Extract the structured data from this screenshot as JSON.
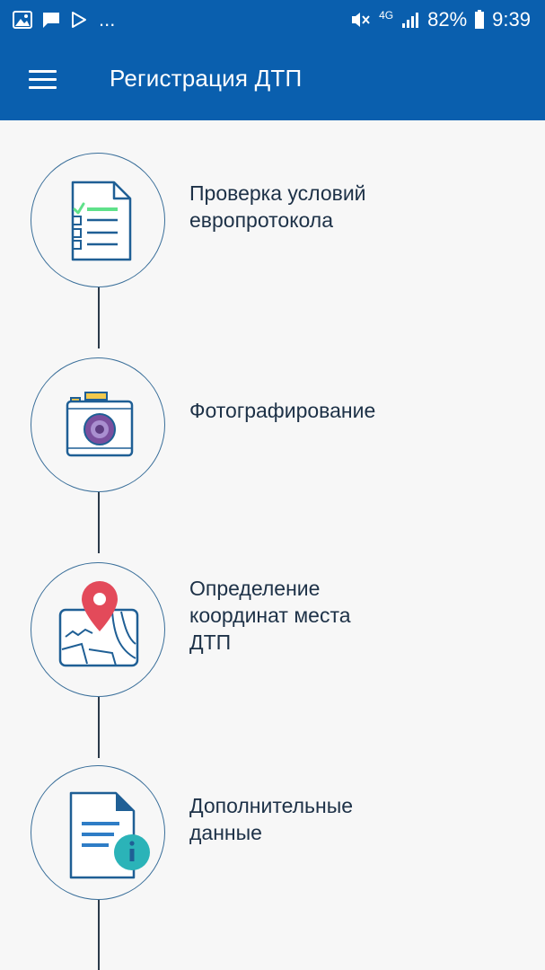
{
  "status_bar": {
    "dots": "...",
    "network": "4G",
    "battery": "82%",
    "time": "9:39",
    "icons": [
      "image-icon",
      "message-icon",
      "play-store-icon",
      "mute-icon",
      "signal-icon",
      "battery-icon"
    ]
  },
  "app_bar": {
    "title": "Регистрация ДТП",
    "menu_icon": "hamburger-menu-icon"
  },
  "steps": [
    {
      "label": "Проверка условий европротокола",
      "icon": "checklist-document-icon"
    },
    {
      "label": "Фотографирование",
      "icon": "camera-icon"
    },
    {
      "label": "Определение координат места ДТП",
      "icon": "map-pin-icon"
    },
    {
      "label": "Дополнительные данные",
      "icon": "document-info-icon"
    }
  ],
  "colors": {
    "primary": "#0a5fae",
    "background": "#f7f7f7",
    "outline": "#1f5f95",
    "accent_green": "#5fe18a",
    "accent_purple": "#7a4f9e",
    "accent_red": "#e34a5a",
    "accent_teal": "#2bb3b8"
  }
}
